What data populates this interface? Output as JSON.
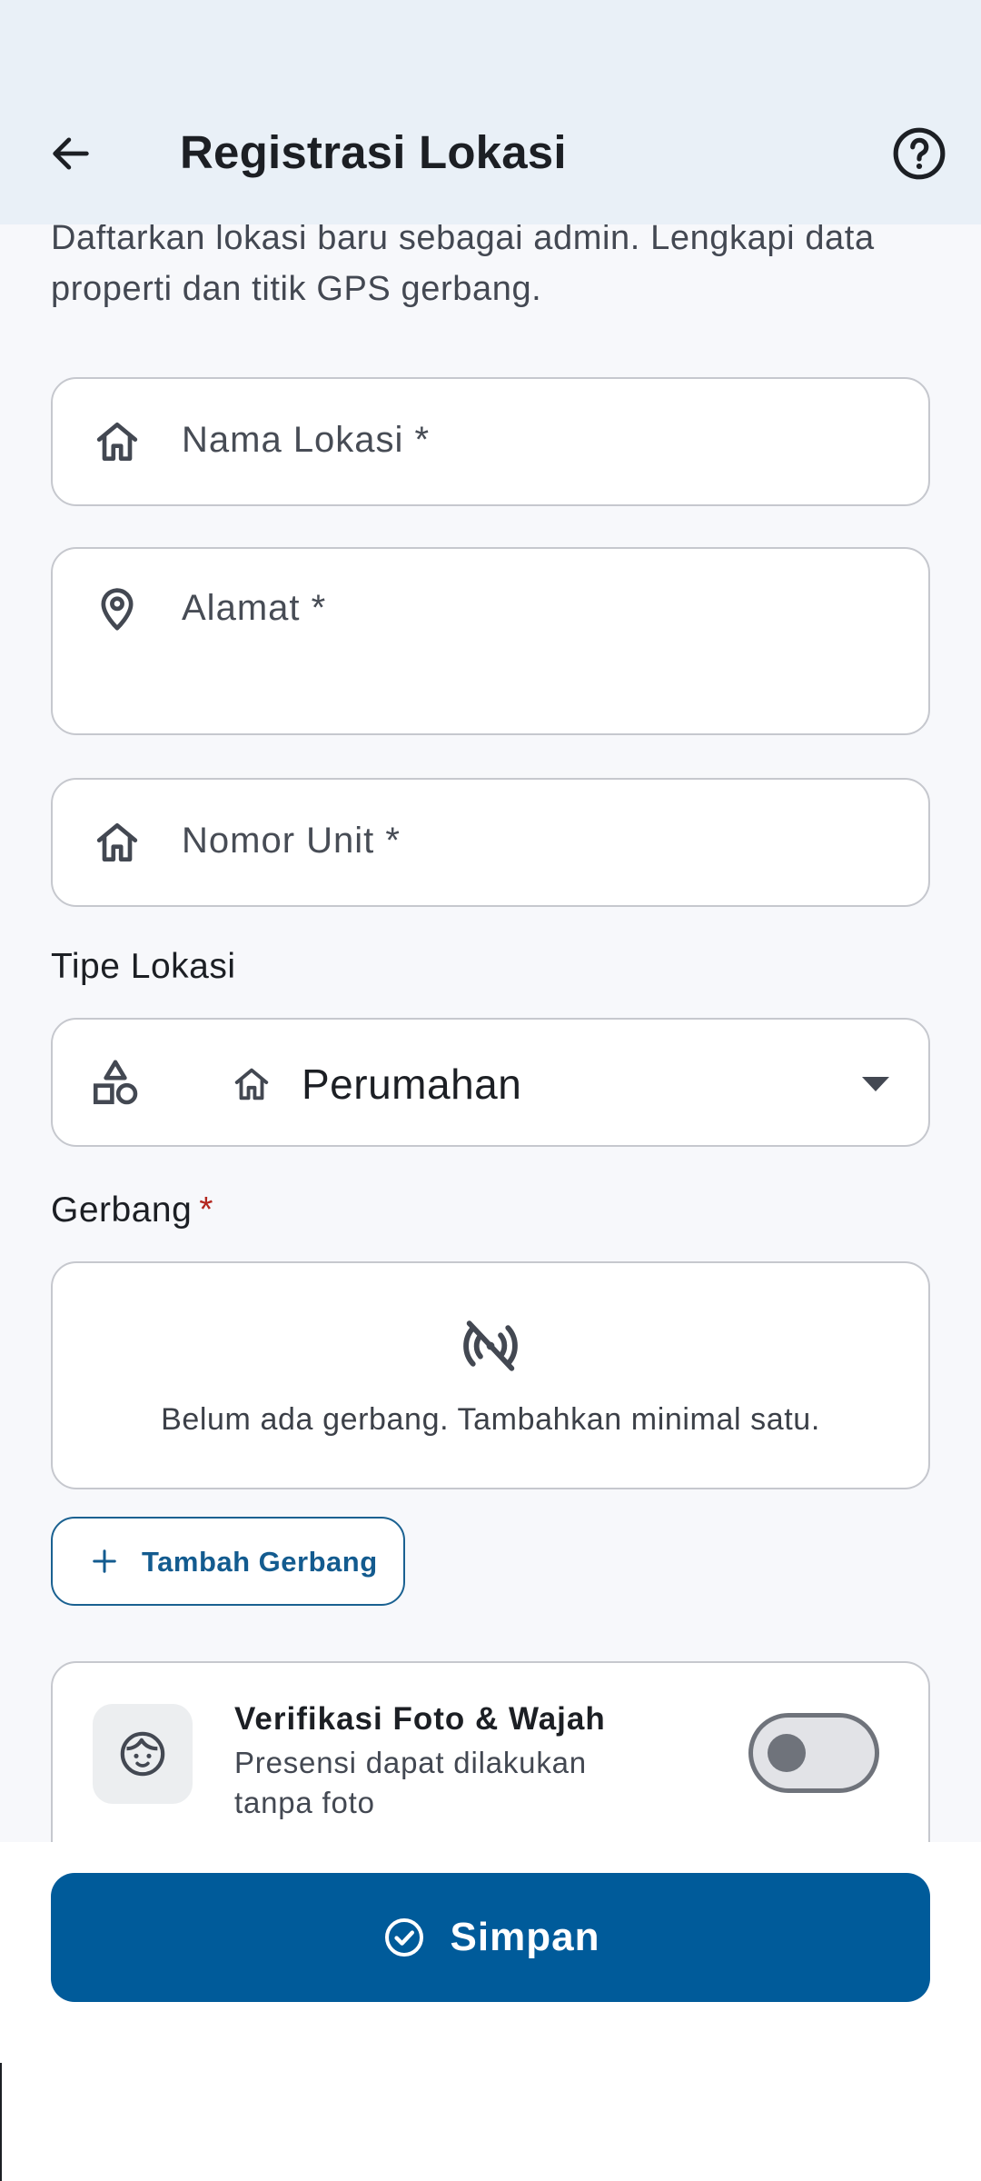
{
  "appbar": {
    "title": "Registrasi Lokasi",
    "back_icon": "arrow-back-icon",
    "help_icon": "help-circle-icon"
  },
  "intro": "Daftarkan lokasi baru sebagai admin. Lengkapi data properti dan titik GPS gerbang.",
  "form": {
    "name_label": "Nama Lokasi *",
    "address_label": "Alamat *",
    "unit_label": "Nomor Unit *",
    "type_section_label": "Tipe Lokasi",
    "type_selected": "Perumahan",
    "gate_section_label": "Gerbang",
    "gate_required_mark": "*",
    "gate_empty_text": "Belum ada gerbang. Tambahkan minimal satu.",
    "add_gate_label": "Tambah Gerbang",
    "verify_title": "Verifikasi Foto & Wajah",
    "verify_subtitle": "Presensi dapat dilakukan tanpa foto",
    "verify_enabled": false
  },
  "actions": {
    "save_label": "Simpan"
  },
  "colors": {
    "appbar_bg": "#e9f0f7",
    "primary": "#005b9a",
    "outline_button": "#135b8f",
    "required": "#b3261e"
  }
}
